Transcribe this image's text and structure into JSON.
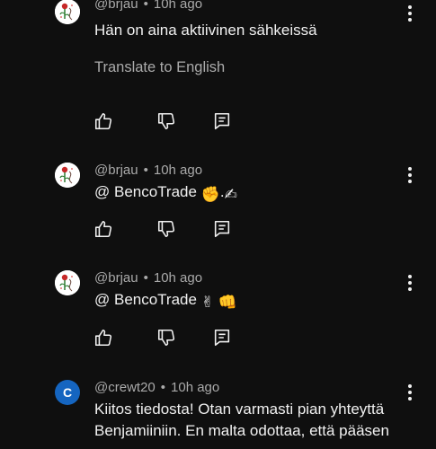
{
  "comments": [
    {
      "handle": "@brjau",
      "time": "10h ago",
      "text": "Hän on aina aktiivinen sähkeissä",
      "translate_label": "Translate to English"
    },
    {
      "handle": "@brjau",
      "time": "10h ago",
      "text": "@ BencoTrade",
      "emoji_1": "✊",
      "emoji_sep": ".",
      "emoji_2": "✍"
    },
    {
      "handle": "@brjau",
      "time": "10h ago",
      "text": "@ BencoTrade",
      "emoji_1": "✌",
      "emoji_2": "👊"
    },
    {
      "handle": "@crewt20",
      "time": "10h ago",
      "avatar_letter": "C",
      "line1": "Kiitos tiedosta! Otan varmasti pian yhteyttä",
      "line2": "Benjamiiniin. En malta odottaa, että pääsen"
    }
  ],
  "separator": "•",
  "colors": {
    "background": "#0f0f0f",
    "primary_text": "#f1f1f1",
    "secondary_text": "#aaaaaa",
    "avatar_c": "#1565c0"
  },
  "icons": [
    "like-icon",
    "dislike-icon",
    "reply-icon",
    "more-vert-icon"
  ]
}
